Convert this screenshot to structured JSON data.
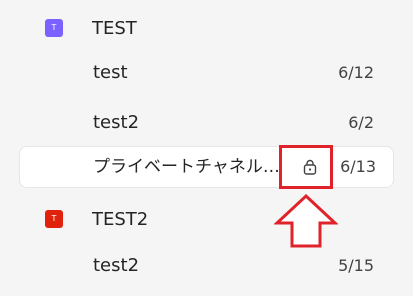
{
  "teams": [
    {
      "avatar_letter": "T",
      "avatar_color": "#7b61ff",
      "name": "TEST",
      "channels": [
        {
          "name": "test",
          "date": "6/12"
        },
        {
          "name": "test2",
          "date": "6/2"
        },
        {
          "name": "プライベートチャネルテ...",
          "date": "6/13",
          "private": true,
          "selected": true,
          "icon": "lock-icon"
        }
      ]
    },
    {
      "avatar_letter": "T",
      "avatar_color": "#e0220c",
      "name": "TEST2",
      "channels": [
        {
          "name": "test2",
          "date": "5/15"
        }
      ]
    }
  ],
  "annotation": {
    "color": "#e0222b",
    "type": "red box and up arrow highlighting lock icon"
  }
}
